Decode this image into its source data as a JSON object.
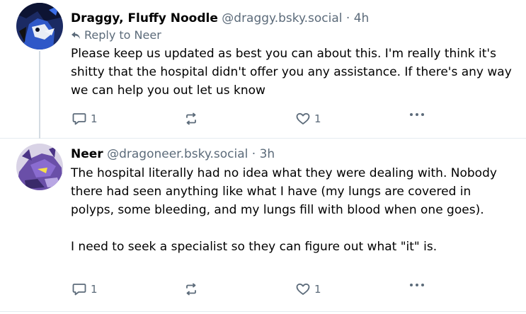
{
  "posts": [
    {
      "author_name": "Draggy, Fluffy Noodle",
      "handle": "@draggy.bsky.social",
      "separator": "·",
      "time": "4h",
      "reply_to": "Reply to Neer",
      "text": "Please keep us updated as best you can about this. I'm really think it's shitty that the hospital didn't offer you any assistance. If there's any way we can help you out let us know",
      "reply_count": "1",
      "like_count": "1"
    },
    {
      "author_name": "Neer",
      "handle": "@dragoneer.bsky.social",
      "separator": "·",
      "time": "3h",
      "text": "The hospital literally had no idea what they were dealing with. Nobody there had seen anything like what I have (my lungs are covered in polyps, some bleeding, and my lungs fill with blood when one goes).\n\nI need to seek a specialist so they can figure out what \"it\" is.",
      "reply_count": "1",
      "like_count": "1"
    }
  ],
  "icons": {
    "reply": "comment-icon",
    "repost": "repost-icon",
    "like": "heart-icon",
    "more": "more-dots-icon",
    "reply_arrow": "reply-arrow-icon"
  },
  "colors": {
    "meta": "#5c6b7a",
    "divider": "#e6ebf0"
  }
}
